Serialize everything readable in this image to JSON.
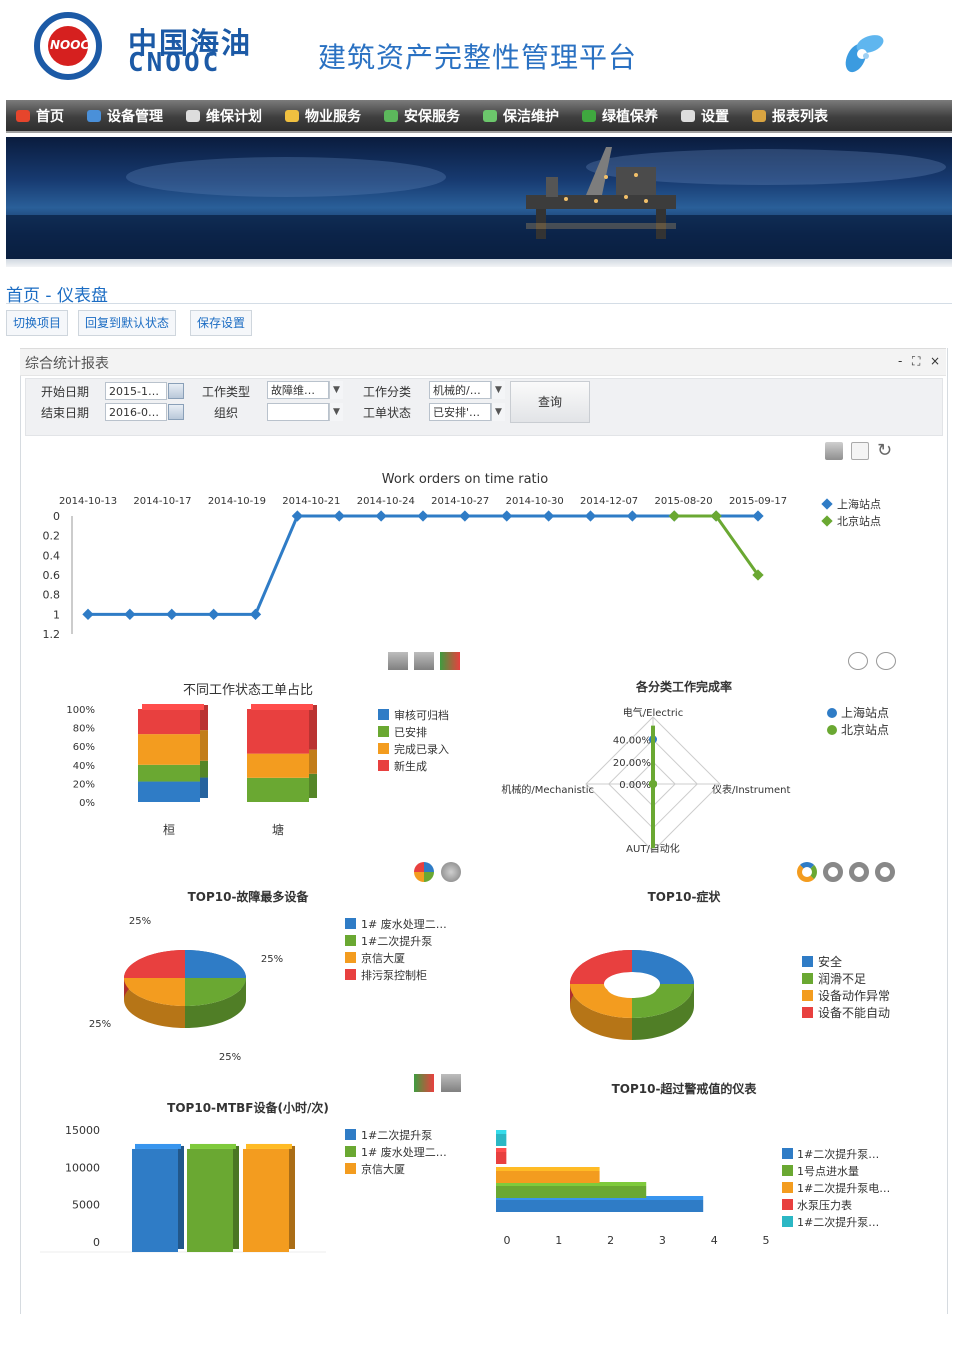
{
  "header": {
    "logo_cn": "中国海油",
    "logo_en": "CNOOC",
    "logo_badge": "NOOC",
    "platform_title": "建筑资产完整性管理平台"
  },
  "nav": [
    {
      "label": "首页",
      "icon": "home-icon",
      "color": "#e6452c"
    },
    {
      "label": "设备管理",
      "icon": "globe-icon",
      "color": "#4a90d9"
    },
    {
      "label": "维保计划",
      "icon": "calendar-icon",
      "color": "#dddddd"
    },
    {
      "label": "物业服务",
      "icon": "house-icon",
      "color": "#f0c040"
    },
    {
      "label": "安保服务",
      "icon": "shield-icon",
      "color": "#5cb85c"
    },
    {
      "label": "保洁维护",
      "icon": "broom-icon",
      "color": "#6cc76c"
    },
    {
      "label": "绿植保养",
      "icon": "plant-icon",
      "color": "#3fa83f"
    },
    {
      "label": "设置",
      "icon": "gear-icon",
      "color": "#dddddd"
    },
    {
      "label": "报表列表",
      "icon": "report-icon",
      "color": "#d9a441"
    }
  ],
  "breadcrumb": "首页 - 仪表盘",
  "actions": {
    "switch": "切换项目",
    "restore": "回复到默认状态",
    "save": "保存设置"
  },
  "panel": {
    "title": "综合统计报表",
    "controls": [
      "-",
      "⛶",
      "×"
    ]
  },
  "filters": {
    "start_label": "开始日期",
    "start_value": "2015-1…",
    "end_label": "结束日期",
    "end_value": "2016-0…",
    "worktype_label": "工作类型",
    "worktype_value": "故障维…",
    "org_label": "组织",
    "org_value": "",
    "category_label": "工作分类",
    "category_value": "机械的/…",
    "status_label": "工单状态",
    "status_value": "已安排'…",
    "query": "查询"
  },
  "chart_data": [
    {
      "type": "line",
      "title": "Work orders on time ratio",
      "x_labels": [
        "2014-10-13",
        "2014-10-17",
        "2014-10-19",
        "2014-10-21",
        "2014-10-24",
        "2014-10-27",
        "2014-10-30",
        "2014-12-07",
        "2015-08-20",
        "2015-09-17"
      ],
      "yticks": [
        "0",
        "0.2",
        "0.4",
        "0.6",
        "0.8",
        "1",
        "1.2"
      ],
      "ylim": [
        0,
        1.2
      ],
      "y_reversed": true,
      "series": [
        {
          "name": "上海站点",
          "color": "#2f7cc6",
          "values": [
            1,
            1,
            1,
            1,
            1,
            0,
            0,
            0,
            0,
            0,
            0,
            0,
            0,
            0,
            0,
            0,
            0
          ]
        },
        {
          "name": "北京站点",
          "color": "#6aa832",
          "values": [
            null,
            null,
            null,
            null,
            null,
            null,
            null,
            null,
            null,
            null,
            null,
            null,
            null,
            null,
            0,
            0,
            0.6
          ]
        }
      ]
    },
    {
      "type": "bar",
      "title": "不同工作状态工单占比",
      "stacked_percent": true,
      "categories": [
        "桓",
        "塘"
      ],
      "yticks": [
        "100%",
        "80%",
        "60%",
        "40%",
        "20%",
        "0%"
      ],
      "series": [
        {
          "name": "审核可归档",
          "color": "#2f7cc6",
          "values": [
            22,
            0
          ]
        },
        {
          "name": "已安排",
          "color": "#6aa832",
          "values": [
            18,
            26
          ]
        },
        {
          "name": "完成已录入",
          "color": "#f39c1f",
          "values": [
            33,
            26
          ]
        },
        {
          "name": "新生成",
          "color": "#e8403f",
          "values": [
            27,
            48
          ]
        }
      ]
    },
    {
      "type": "radar",
      "title": "各分类工作完成率",
      "axes": [
        "电气/Electric",
        "仪表/Instrument",
        "AUT/自动化",
        "机械的/Mechanistic"
      ],
      "rticks": [
        "40.00%",
        "20.00%",
        "0.00%"
      ],
      "series": [
        {
          "name": "上海站点",
          "color": "#2f7cc6",
          "values": [
            40,
            0,
            0,
            0
          ]
        },
        {
          "name": "北京站点",
          "color": "#6aa832",
          "values": [
            0,
            0,
            0,
            0
          ]
        }
      ]
    },
    {
      "type": "pie",
      "title": "TOP10-故障最多设备",
      "labels": [
        "1# 废水处理二…",
        "1#二次提升泵",
        "京信大厦",
        "排污泵控制柜"
      ],
      "values": [
        25,
        25,
        25,
        25
      ],
      "value_labels": [
        "25%",
        "25%",
        "25%",
        "25%"
      ],
      "colors": [
        "#2f7cc6",
        "#6aa832",
        "#f39c1f",
        "#e8403f"
      ]
    },
    {
      "type": "pie",
      "title": "TOP10-症状",
      "donut": true,
      "labels": [
        "安全",
        "润滑不足",
        "设备动作异常",
        "设备不能自动"
      ],
      "values": [
        25,
        25,
        25,
        25
      ],
      "colors": [
        "#2f7cc6",
        "#6aa832",
        "#f39c1f",
        "#e8403f"
      ]
    },
    {
      "type": "bar",
      "title": "TOP10-MTBF设备(小时/次)",
      "categories": [
        "1#二次提升泵",
        "1# 废水处理二…",
        "京信大厦"
      ],
      "values": [
        13800,
        13800,
        13800
      ],
      "yticks": [
        "15000",
        "10000",
        "5000",
        "0"
      ],
      "ylim": [
        0,
        15000
      ],
      "colors": [
        "#2f7cc6",
        "#6aa832",
        "#f39c1f"
      ]
    },
    {
      "type": "bar",
      "orientation": "horizontal",
      "title": "TOP10-超过警戒值的仪表",
      "categories": [
        "1#二次提升泵…",
        "1号点进水量",
        "1#二次提升泵电…",
        "水泵压力表",
        "1#二次提升泵…"
      ],
      "values": [
        4,
        2.9,
        2,
        0.2,
        0.2
      ],
      "colors": [
        "#2f7cc6",
        "#6aa832",
        "#f39c1f",
        "#e8403f",
        "#2bb7c4"
      ],
      "xticks": [
        "0",
        "1",
        "2",
        "3",
        "4",
        "5"
      ],
      "xlim": [
        0,
        5
      ]
    }
  ]
}
